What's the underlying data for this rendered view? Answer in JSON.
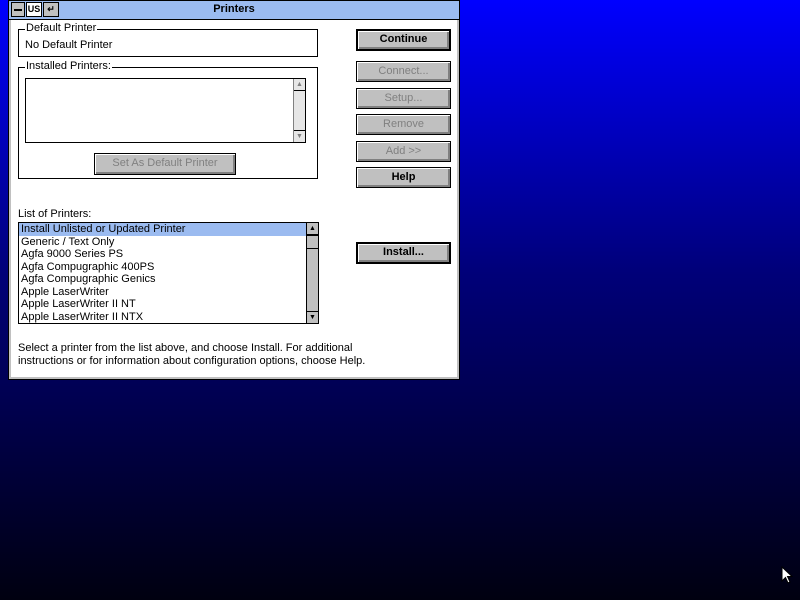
{
  "window": {
    "title": "Printers",
    "lang_indicator": "US"
  },
  "default_printer": {
    "legend": "Default Printer",
    "value": "No Default Printer"
  },
  "installed_printers": {
    "legend": "Installed Printers:",
    "items": [],
    "set_default_label": "Set As Default Printer"
  },
  "buttons": {
    "continue": "Continue",
    "connect": "Connect...",
    "setup": "Setup...",
    "remove": "Remove",
    "add": "Add >>",
    "help": "Help",
    "install": "Install..."
  },
  "list_of_printers": {
    "label": "List of Printers:",
    "selected_index": 0,
    "items": [
      "Install Unlisted or Updated Printer",
      "Generic / Text Only",
      "Agfa 9000 Series PS",
      "Agfa Compugraphic 400PS",
      "Agfa Compugraphic Genics",
      "Apple LaserWriter",
      "Apple LaserWriter II NT",
      "Apple LaserWriter II NTX"
    ]
  },
  "instructions": {
    "line1": "Select a printer from the list above, and choose Install. For additional",
    "line2": "instructions or for information about configuration options, choose Help."
  },
  "colors": {
    "title_bar": "#9bbbf0",
    "selection": "#9bbbf0",
    "desktop_top": "#0000ff",
    "desktop_bottom": "#000010"
  }
}
